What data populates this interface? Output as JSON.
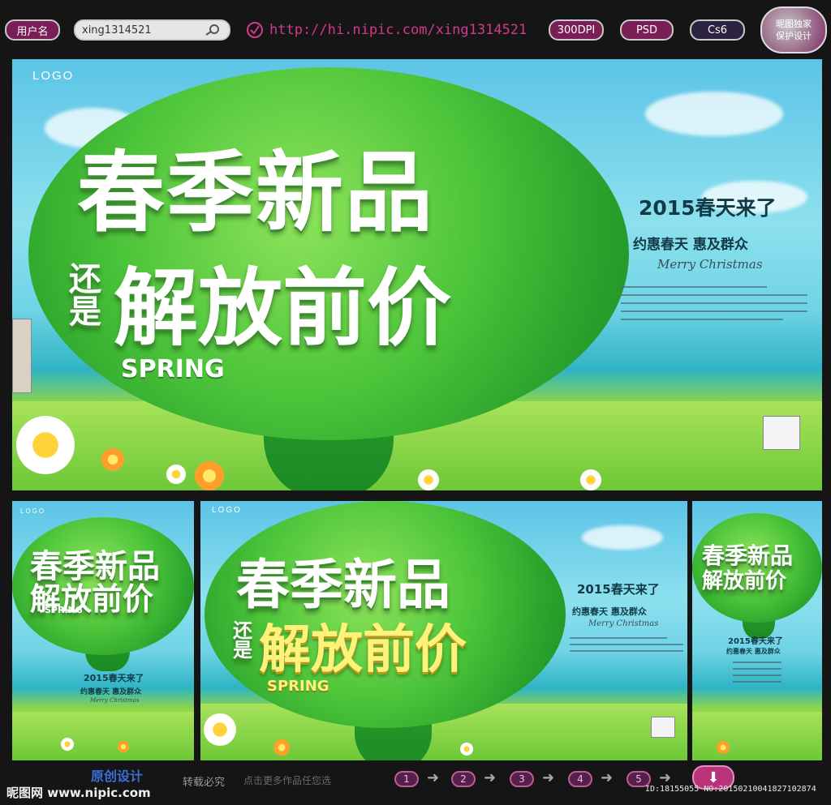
{
  "toolbar": {
    "user_label": "用户名",
    "username": "xing1314521",
    "url": "http://hi.nipic.com/xing1314521",
    "dpi": "300DPI",
    "format": "PSD",
    "version": "Cs6",
    "badge_line1": "昵图独家",
    "badge_line2": "保护设计"
  },
  "poster": {
    "logo": "LOGO",
    "title_line1": "春季新品",
    "title_prefix": "还是",
    "title_line2": "解放前价",
    "spring": "SPRING",
    "year_text": "2015春天来了",
    "slogan": "约惠春天  惠及群众",
    "script": "Merry Christmas"
  },
  "footer": {
    "original": "原创设计",
    "reprint": "转载必究",
    "hint": "点击更多作品任您选",
    "pages": [
      "1",
      "2",
      "3",
      "4",
      "5"
    ],
    "site": "昵图网 www.nipic.com",
    "id_text": "ID:18155055 NO:20150210041827102874"
  },
  "colors": {
    "accent": "#7a1f55",
    "grass": "#8ed548",
    "sky": "#5cc4e6"
  },
  "icons": {
    "search": "search-icon",
    "check": "check-circle-icon",
    "download": "download-arrow-icon"
  }
}
